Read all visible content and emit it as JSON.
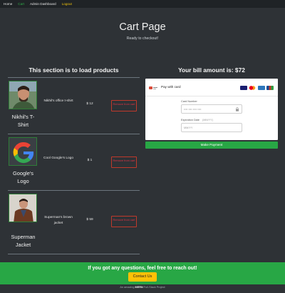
{
  "nav": {
    "home": "Home",
    "cart": "Cart",
    "admin": "Admin Dashboard",
    "logout": "Logout"
  },
  "hero": {
    "title": "Cart Page",
    "subtitle": "Ready to checkout!"
  },
  "products_section": {
    "heading": "This section is to load products",
    "remove_label": "Remove from cart",
    "items": [
      {
        "name": "Nikhil's T-Shirt",
        "description": "Nikhil's office t-shirt",
        "price": "$ 12"
      },
      {
        "name": "Google's Logo",
        "description": "Cool Google's Logo",
        "price": "$ 1"
      },
      {
        "name": "Superman Jacket",
        "description": "Superman's brown jacket",
        "price": "$ 59"
      }
    ]
  },
  "bill": {
    "heading": "Your bill amount is: $72"
  },
  "payment": {
    "title": "Pay with card",
    "card_number_label": "Card Number",
    "card_number_placeholder": "•••• •••• •••• ••••",
    "expiry_label": "Expiration Date",
    "expiry_hint": "(MM/YY)",
    "expiry_placeholder": "MM/YY",
    "button": "Make Payment",
    "card_brands": [
      {
        "name": "visa",
        "color": "#1a1f71"
      },
      {
        "name": "mastercard",
        "color": "#eb001b"
      },
      {
        "name": "amex",
        "color": "#2e77bc"
      },
      {
        "name": "jcb",
        "color": "#c0392b"
      }
    ]
  },
  "footer": {
    "text": "If you got any questions, feel free to reach out!",
    "contact_button": "Contact Us"
  },
  "credit": {
    "prefix": "An amazing",
    "highlight": "MERN",
    "suffix": "Full-Stack Project"
  },
  "colors": {
    "background": "#2e3236",
    "navbar": "#1f2326",
    "accent_green": "#28a745",
    "danger": "#dc3545",
    "warning": "#ffc107"
  }
}
